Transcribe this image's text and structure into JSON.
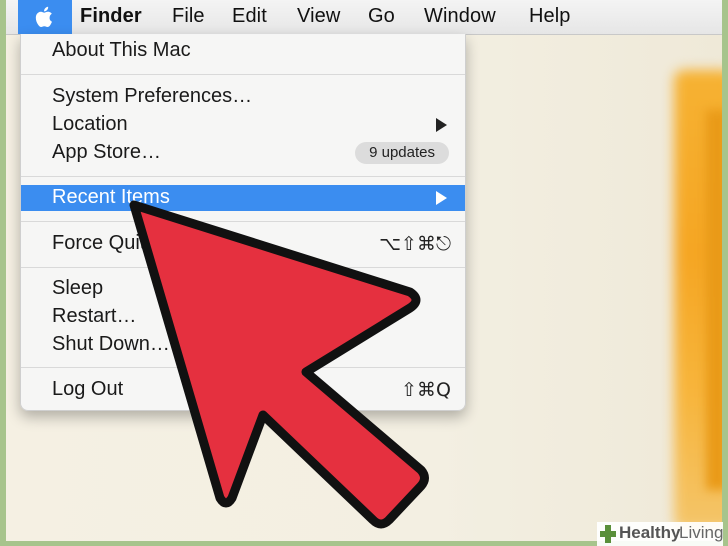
{
  "menubar": {
    "app_name": "Finder",
    "items": [
      "File",
      "Edit",
      "View",
      "Go",
      "Window",
      "Help"
    ]
  },
  "apple_menu": {
    "about": "About This Mac",
    "system_preferences": "System Preferences…",
    "location": "Location",
    "app_store": "App Store…",
    "app_store_badge": "9 updates",
    "recent_items": "Recent Items",
    "force_quit": "Force Quit",
    "force_quit_shortcut": "⌥⇧⌘⎋",
    "sleep": "Sleep",
    "restart": "Restart…",
    "shut_down": "Shut Down…",
    "log_out": "Log Out",
    "log_out_shortcut": "⇧⌘Q"
  },
  "watermark": {
    "word1": "Healthy",
    "word2": "Living"
  },
  "colors": {
    "highlight": "#3b8df0",
    "arrow": "#e5303f",
    "frame": "#a7c48c"
  },
  "icons": [
    "apple-logo-icon",
    "submenu-arrow-icon",
    "red-pointer-arrow-icon",
    "healthy-living-cross-icon"
  ]
}
